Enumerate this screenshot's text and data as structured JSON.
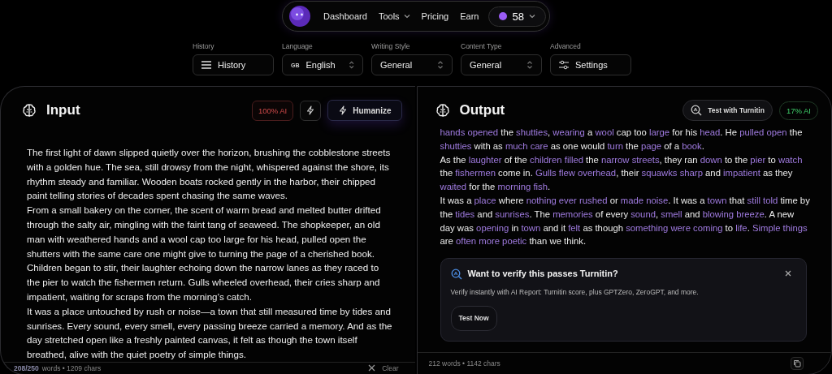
{
  "nav": {
    "items": [
      {
        "label": "Dashboard",
        "dropdown": false
      },
      {
        "label": "Tools",
        "dropdown": true
      },
      {
        "label": "Pricing",
        "dropdown": false
      },
      {
        "label": "Earn",
        "dropdown": false
      }
    ],
    "credits": "58"
  },
  "toolbar": [
    {
      "label": "History",
      "kind": "button",
      "value": "History"
    },
    {
      "label": "Language",
      "kind": "select",
      "badge": "GB",
      "value": "English"
    },
    {
      "label": "Writing Style",
      "kind": "select",
      "value": "General"
    },
    {
      "label": "Content Type",
      "kind": "select",
      "value": "General"
    },
    {
      "label": "Advanced",
      "kind": "settings",
      "value": "Settings"
    }
  ],
  "input": {
    "title": "Input",
    "ai_score": "100% AI",
    "humanize": "Humanize",
    "paragraphs": [
      "The first light of dawn slipped quietly over the horizon, brushing the cobblestone streets with a golden hue. The sea, still drowsy from the night, whispered against the shore, its rhythm steady and familiar. Wooden boats rocked gently in the harbor, their chipped paint telling stories of decades spent chasing the same waves.",
      "From a small bakery on the corner, the scent of warm bread and melted butter drifted through the salty air, mingling with the faint tang of seaweed. The shopkeeper, an old man with weathered hands and a wool cap too large for his head, pulled open the shutters with the same care one might give to turning the page of a cherished book.",
      "Children began to stir, their laughter echoing down the narrow lanes as they raced to the pier to watch the fishermen return. Gulls wheeled overhead, their cries sharp and impatient, waiting for scraps from the morning’s catch.",
      "It was a place untouched by rush or noise—a town that still measured time by tides and sunrises. Every sound, every smell, every passing breeze carried a memory. And as the day stretched open like a freshly painted canvas, it felt as though the town itself breathed, alive with the quiet poetry of simple things."
    ],
    "word_count": "208/250",
    "words_label": "words • 1209 chars",
    "clear": "Clear"
  },
  "output": {
    "title": "Output",
    "turnitin": "Test with Turnitin",
    "ai_score": "17% AI",
    "paragraphs": [
      [
        {
          "text": "hands opened",
          "changed": true
        },
        {
          "text": " the ",
          "changed": false
        },
        {
          "text": "shutties",
          "changed": true
        },
        {
          "text": ", ",
          "changed": false
        },
        {
          "text": "wearing",
          "changed": true
        },
        {
          "text": " a ",
          "changed": false
        },
        {
          "text": "wool",
          "changed": true
        },
        {
          "text": " cap too ",
          "changed": false
        },
        {
          "text": "large",
          "changed": true
        },
        {
          "text": " for his ",
          "changed": false
        },
        {
          "text": "head",
          "changed": true
        },
        {
          "text": ". He ",
          "changed": false
        },
        {
          "text": "pulled open",
          "changed": true
        },
        {
          "text": " the ",
          "changed": false
        },
        {
          "text": "shutties",
          "changed": true
        },
        {
          "text": " with as ",
          "changed": false
        },
        {
          "text": "much care",
          "changed": true
        },
        {
          "text": " as one would ",
          "changed": false
        },
        {
          "text": "turn",
          "changed": true
        },
        {
          "text": " the ",
          "changed": false
        },
        {
          "text": "page",
          "changed": true
        },
        {
          "text": " of a ",
          "changed": false
        },
        {
          "text": "book",
          "changed": true
        },
        {
          "text": ".",
          "changed": false
        }
      ],
      [
        {
          "text": "As the ",
          "changed": false
        },
        {
          "text": "laughter",
          "changed": true
        },
        {
          "text": " of the ",
          "changed": false
        },
        {
          "text": "children filled",
          "changed": true
        },
        {
          "text": " the ",
          "changed": false
        },
        {
          "text": "narrow streets",
          "changed": true
        },
        {
          "text": ", they ran ",
          "changed": false
        },
        {
          "text": "down",
          "changed": true
        },
        {
          "text": " to the ",
          "changed": false
        },
        {
          "text": "pier",
          "changed": true
        },
        {
          "text": " to ",
          "changed": false
        },
        {
          "text": "watch",
          "changed": true
        },
        {
          "text": " the ",
          "changed": false
        },
        {
          "text": "fishermen",
          "changed": true
        },
        {
          "text": " come in. ",
          "changed": false
        },
        {
          "text": "Gulls flew overhead",
          "changed": true
        },
        {
          "text": ", their ",
          "changed": false
        },
        {
          "text": "squawks sharp",
          "changed": true
        },
        {
          "text": " and ",
          "changed": false
        },
        {
          "text": "impatient",
          "changed": true
        },
        {
          "text": " as they ",
          "changed": false
        },
        {
          "text": "waited",
          "changed": true
        },
        {
          "text": " for the ",
          "changed": false
        },
        {
          "text": "morning fish",
          "changed": true
        },
        {
          "text": ".",
          "changed": false
        }
      ],
      [
        {
          "text": "It was a ",
          "changed": false
        },
        {
          "text": "place",
          "changed": true
        },
        {
          "text": " where ",
          "changed": false
        },
        {
          "text": "nothing ever rushed",
          "changed": true
        },
        {
          "text": " or ",
          "changed": false
        },
        {
          "text": "made noise",
          "changed": true
        },
        {
          "text": ". It was a ",
          "changed": false
        },
        {
          "text": "town",
          "changed": true
        },
        {
          "text": " that ",
          "changed": false
        },
        {
          "text": "still told",
          "changed": true
        },
        {
          "text": " time by the ",
          "changed": false
        },
        {
          "text": "tides",
          "changed": true
        },
        {
          "text": " and ",
          "changed": false
        },
        {
          "text": "sunrises",
          "changed": true
        },
        {
          "text": ". The ",
          "changed": false
        },
        {
          "text": "memories",
          "changed": true
        },
        {
          "text": " of every ",
          "changed": false
        },
        {
          "text": "sound",
          "changed": true
        },
        {
          "text": ", ",
          "changed": false
        },
        {
          "text": "smell",
          "changed": true
        },
        {
          "text": " and ",
          "changed": false
        },
        {
          "text": "blowing breeze",
          "changed": true
        },
        {
          "text": ". A new day was ",
          "changed": false
        },
        {
          "text": "opening",
          "changed": true
        },
        {
          "text": " in ",
          "changed": false
        },
        {
          "text": "town",
          "changed": true
        },
        {
          "text": " and it ",
          "changed": false
        },
        {
          "text": "felt",
          "changed": true
        },
        {
          "text": " as though ",
          "changed": false
        },
        {
          "text": "something were coming",
          "changed": true
        },
        {
          "text": " to ",
          "changed": false
        },
        {
          "text": "life",
          "changed": true
        },
        {
          "text": ". ",
          "changed": false
        },
        {
          "text": "Simple things",
          "changed": true
        },
        {
          "text": " are ",
          "changed": false
        },
        {
          "text": "often more poetic",
          "changed": true
        },
        {
          "text": " than we think.",
          "changed": false
        }
      ]
    ],
    "notice": {
      "title": "Want to verify this passes Turnitin?",
      "text": "Verify instantly with AI Report: Turnitin score, plus GPTZero, ZeroGPT, and more.",
      "button": "Test Now"
    },
    "stats": "212 words • 1142 chars"
  }
}
